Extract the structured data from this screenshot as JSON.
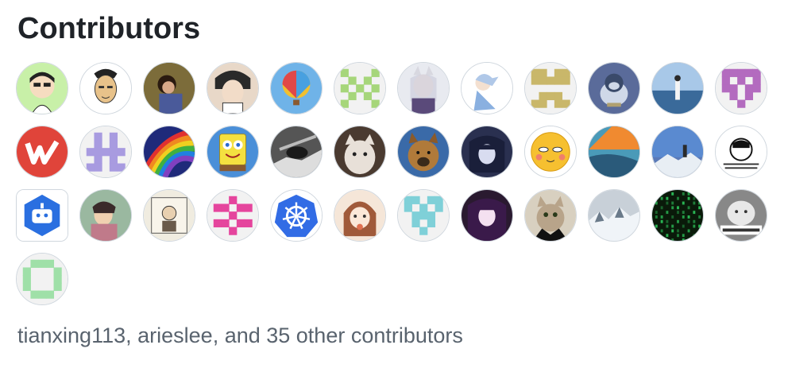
{
  "section": {
    "title": "Contributors"
  },
  "contributors": [
    {
      "kind": "cartoon-boy",
      "bg": "#c8f0a8"
    },
    {
      "kind": "sketch-face",
      "bg": "#ffffff"
    },
    {
      "kind": "photo-child",
      "bg": "#7a7a3a"
    },
    {
      "kind": "anime-man",
      "bg": "#e8d8c8"
    },
    {
      "kind": "hot-air-balloon",
      "bg": "#6fb3e8"
    },
    {
      "kind": "identicon-green",
      "bg": "#f2f2f2"
    },
    {
      "kind": "anime-wolf",
      "bg": "#e8eaf0"
    },
    {
      "kind": "anime-girl",
      "bg": "#ffffff"
    },
    {
      "kind": "identicon-olive",
      "bg": "#f2f2f2"
    },
    {
      "kind": "snorlax",
      "bg": "#5a6b9a"
    },
    {
      "kind": "photo-sea",
      "bg": "#6f9fd0"
    },
    {
      "kind": "identicon-purple",
      "bg": "#f2f2f2"
    },
    {
      "kind": "w-logo",
      "bg": "#e0443a"
    },
    {
      "kind": "identicon-lavender",
      "bg": "#f2f2f2"
    },
    {
      "kind": "rainbow-swirl",
      "bg": "#1f2a7a"
    },
    {
      "kind": "spongebob",
      "bg": "#4a8fd8"
    },
    {
      "kind": "photo-cat-stairs",
      "bg": "#555555"
    },
    {
      "kind": "photo-cat-face",
      "bg": "#4a3a30"
    },
    {
      "kind": "photo-dog",
      "bg": "#3a6aa8"
    },
    {
      "kind": "anime-dark",
      "bg": "#2a3050"
    },
    {
      "kind": "smiley-face",
      "bg": "#ffffff"
    },
    {
      "kind": "photo-sunset",
      "bg": "#4a8ab0"
    },
    {
      "kind": "photo-mountain",
      "bg": "#5a7ab8"
    },
    {
      "kind": "meme-face",
      "bg": "#ffffff"
    },
    {
      "kind": "robot-logo",
      "bg": "#2a6fe0"
    },
    {
      "kind": "painting-woman",
      "bg": "#7fb0a0"
    },
    {
      "kind": "cartoon-book",
      "bg": "#f0ece0"
    },
    {
      "kind": "identicon-magenta",
      "bg": "#f2f2f2"
    },
    {
      "kind": "kubernetes-logo",
      "bg": "#ffffff"
    },
    {
      "kind": "anime-cat-girl",
      "bg": "#f5e6d8"
    },
    {
      "kind": "identicon-teal",
      "bg": "#f2f2f2"
    },
    {
      "kind": "anime-purple",
      "bg": "#2a1a30"
    },
    {
      "kind": "photo-tuxedo-cat",
      "bg": "#d8d0c0"
    },
    {
      "kind": "photo-snow",
      "bg": "#c8d0d8"
    },
    {
      "kind": "matrix-code",
      "bg": "#0a1a0a"
    },
    {
      "kind": "meme-text",
      "bg": "#888888"
    },
    {
      "kind": "identicon-mint",
      "bg": "#f2f2f2"
    }
  ],
  "summary": {
    "user1": "tianxing113",
    "sep1": ", ",
    "user2": "arieslee",
    "sep2": ", and ",
    "others": "35 other contributors"
  }
}
